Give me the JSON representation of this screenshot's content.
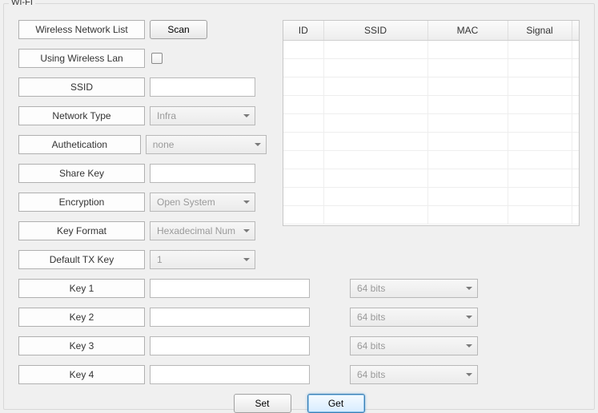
{
  "group_title": "WI-FI",
  "labels": {
    "wireless_network_list": "Wireless Network List",
    "using_wireless_lan": "Using Wireless Lan",
    "ssid": "SSID",
    "network_type": "Network Type",
    "authentication": "Authetication",
    "share_key": "Share Key",
    "encryption": "Encryption",
    "key_format": "Key Format",
    "default_tx_key": "Default TX Key",
    "key1": "Key 1",
    "key2": "Key 2",
    "key3": "Key 3",
    "key4": "Key 4"
  },
  "buttons": {
    "scan": "Scan",
    "set": "Set",
    "get": "Get"
  },
  "values": {
    "using_wireless_lan": false,
    "ssid": "",
    "network_type": "Infra",
    "authentication": "none",
    "share_key": "",
    "encryption": "Open System",
    "key_format": "Hexadecimal Num",
    "default_tx_key": "1",
    "key1": "",
    "key2": "",
    "key3": "",
    "key4": "",
    "key1_bits": "64 bits",
    "key2_bits": "64 bits",
    "key3_bits": "64 bits",
    "key4_bits": "64 bits"
  },
  "table": {
    "columns": {
      "id": "ID",
      "ssid": "SSID",
      "mac": "MAC",
      "signal": "Signal"
    },
    "rows": []
  }
}
